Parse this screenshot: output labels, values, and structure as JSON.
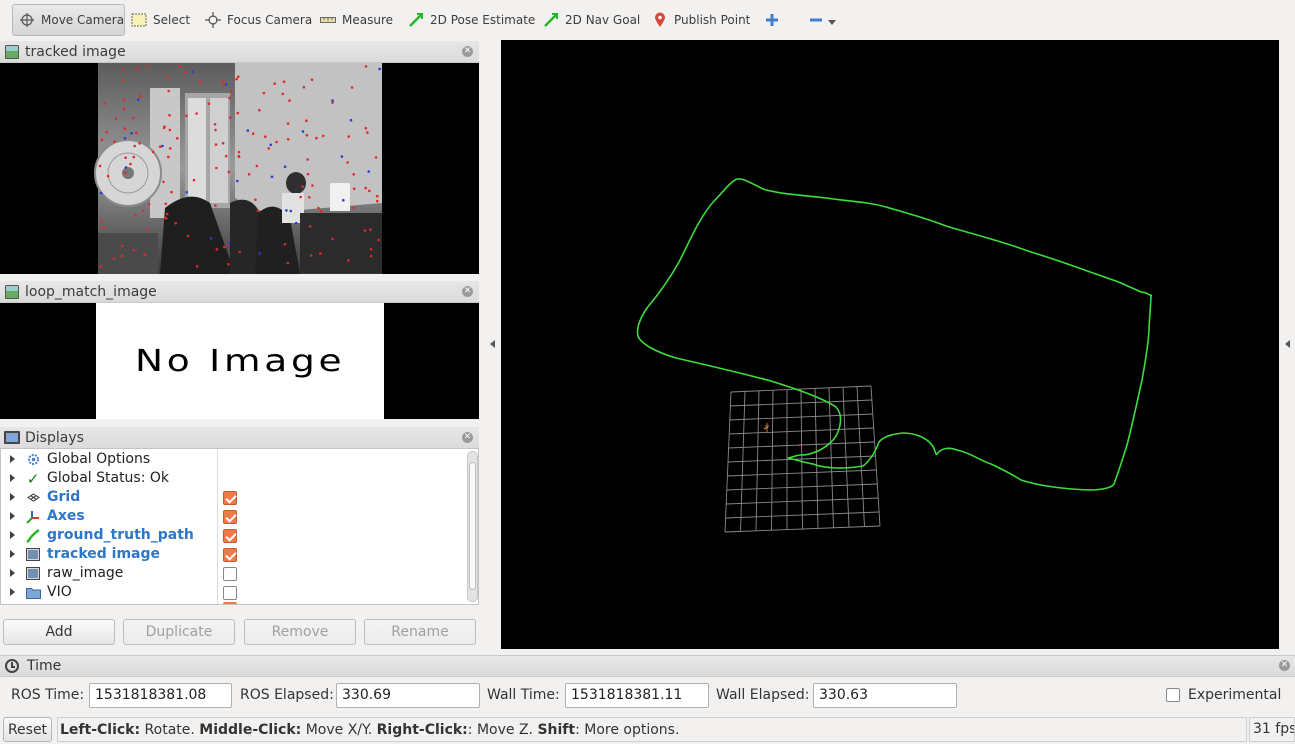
{
  "toolbar": {
    "tools": [
      {
        "label": "Move Camera",
        "icon": "move-camera-icon",
        "active": true
      },
      {
        "label": "Select",
        "icon": "select-icon"
      },
      {
        "label": "Focus Camera",
        "icon": "focus-camera-icon"
      },
      {
        "label": "Measure",
        "icon": "measure-icon"
      },
      {
        "label": "2D Pose Estimate",
        "icon": "pose-arrow-icon"
      },
      {
        "label": "2D Nav Goal",
        "icon": "nav-arrow-icon"
      },
      {
        "label": "Publish Point",
        "icon": "map-pin-icon"
      }
    ],
    "add_icon": "plus-icon",
    "remove_icon": "minus-icon"
  },
  "panels": {
    "tracked_image_title": "tracked image",
    "loop_match_title": "loop_match_image",
    "no_image_text": "No Image",
    "displays_title": "Displays"
  },
  "displays": {
    "items": [
      {
        "label": "Global Options",
        "icon": "gear-icon",
        "checked": null,
        "bold": false
      },
      {
        "label": "Global Status: Ok",
        "icon": "checkmark-icon",
        "checked": null,
        "bold": false
      },
      {
        "label": "Grid",
        "icon": "grid-icon",
        "checked": true,
        "bold": true
      },
      {
        "label": "Axes",
        "icon": "axes-icon",
        "checked": true,
        "bold": true
      },
      {
        "label": "ground_truth_path",
        "icon": "path-icon",
        "checked": true,
        "bold": true
      },
      {
        "label": "tracked image",
        "icon": "image-icon",
        "checked": true,
        "bold": true
      },
      {
        "label": "raw_image",
        "icon": "image-icon",
        "checked": false,
        "bold": false
      },
      {
        "label": "VIO",
        "icon": "folder-icon",
        "checked": false,
        "bold": false
      }
    ],
    "buttons": {
      "add": "Add",
      "duplicate": "Duplicate",
      "remove": "Remove",
      "rename": "Rename"
    }
  },
  "time": {
    "title": "Time",
    "ros_time_label": "ROS Time:",
    "ros_time": "1531818381.08",
    "ros_elapsed_label": "ROS Elapsed:",
    "ros_elapsed": "330.69",
    "wall_time_label": "Wall Time:",
    "wall_time": "1531818381.11",
    "wall_elapsed_label": "Wall Elapsed:",
    "wall_elapsed": "330.63",
    "experimental_label": "Experimental"
  },
  "status": {
    "reset_label": "Reset",
    "hint": [
      {
        "bold": "Left-Click:",
        "text": " Rotate. "
      },
      {
        "bold": "Middle-Click:",
        "text": " Move X/Y. "
      },
      {
        "bold": "Right-Click:",
        "text": ": Move Z. "
      },
      {
        "bold": "Shift",
        "text": ": More options."
      }
    ],
    "fps": "31 fps"
  },
  "colors": {
    "path": "#3ddc3d",
    "grid": "#8a8a8a",
    "link_blue": "#2e76c7",
    "checkbox_orange": "#ef7b4a"
  }
}
